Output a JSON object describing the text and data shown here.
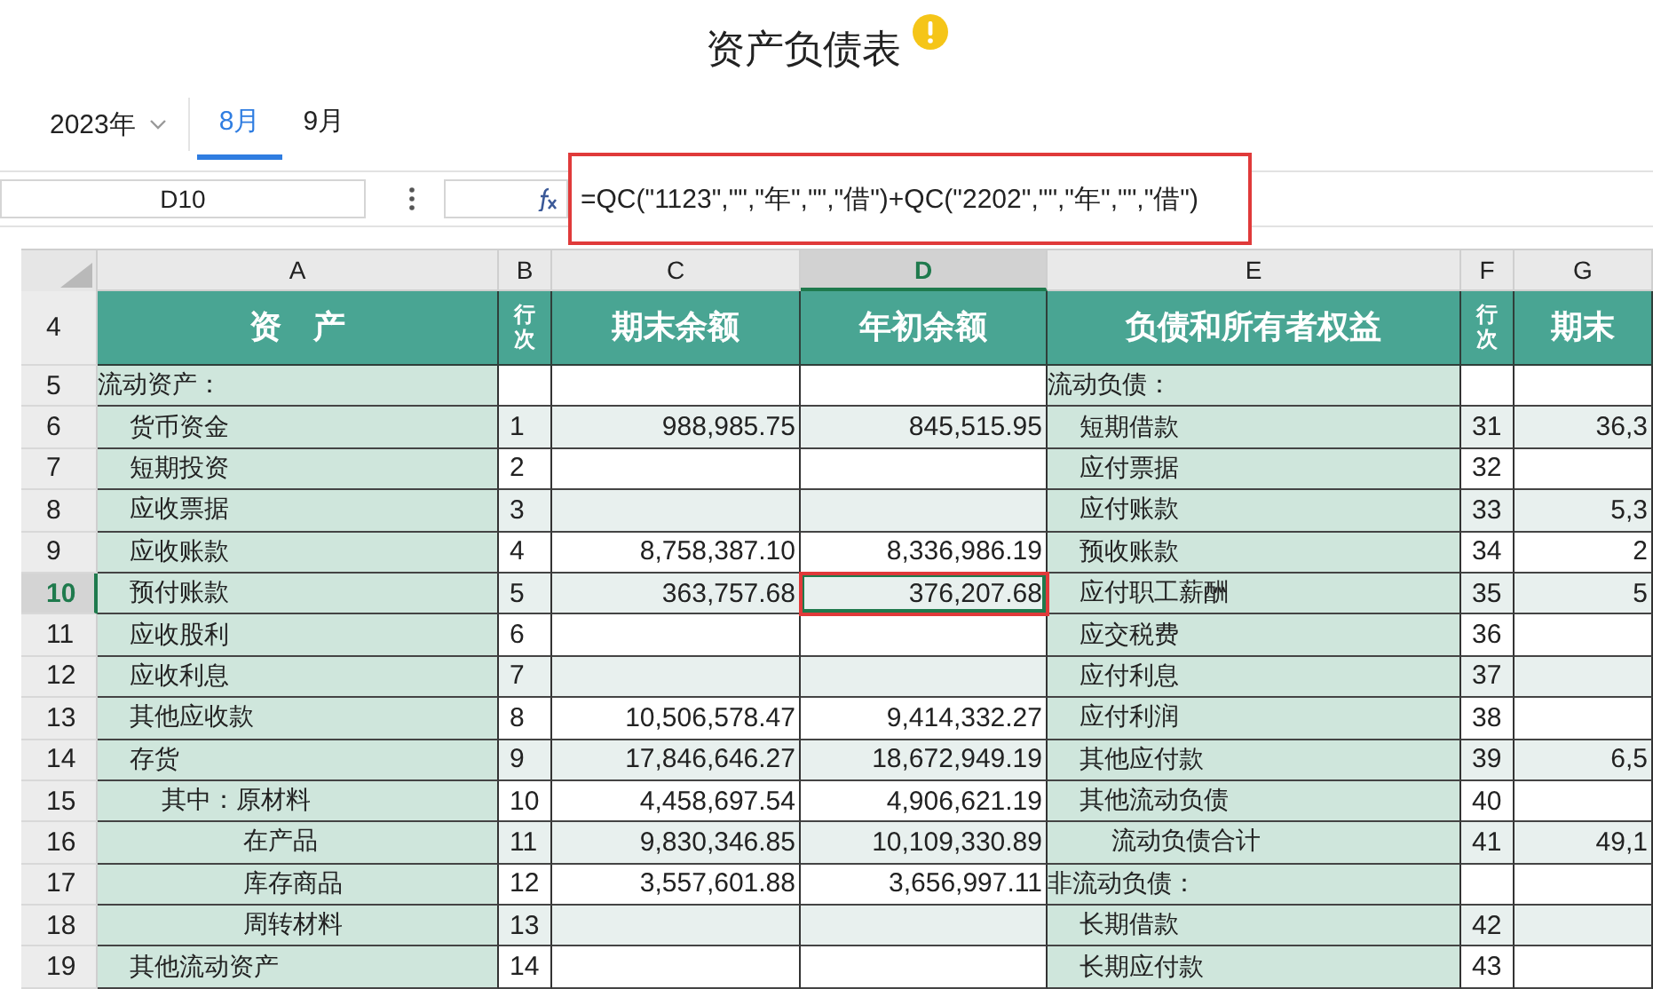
{
  "title": "资产负债表",
  "period": {
    "year": "2023年",
    "months": [
      {
        "label": "8月",
        "selected": true
      },
      {
        "label": "9月",
        "selected": false
      }
    ]
  },
  "formula_bar": {
    "cell_ref": "D10",
    "formula": "=QC(\"1123\",\"\",\"年\",\"\",\"借\")+QC(\"2202\",\"\",\"年\",\"\",\"借\")"
  },
  "sheet": {
    "columns": [
      {
        "label": "A",
        "selected": false
      },
      {
        "label": "B",
        "selected": false
      },
      {
        "label": "C",
        "selected": false
      },
      {
        "label": "D",
        "selected": true
      },
      {
        "label": "E",
        "selected": false
      },
      {
        "label": "F",
        "selected": false
      },
      {
        "label": "G",
        "selected": false
      }
    ],
    "header": {
      "number": "4",
      "selected": false,
      "cells": [
        "资　产",
        "行次",
        "期末余额",
        "年初余额",
        "负债和所有者权益",
        "行次",
        "期末"
      ]
    },
    "rows": [
      {
        "number": "5",
        "selected": false,
        "asset": {
          "text": "流动资产：",
          "kind": "section"
        },
        "line": "",
        "end": "",
        "start": "",
        "liability": {
          "text": "流动负债：",
          "kind": "section"
        },
        "line2": "",
        "end2": ""
      },
      {
        "number": "6",
        "selected": false,
        "asset": {
          "text": "货币资金",
          "kind": "item"
        },
        "line": "1",
        "end": "988,985.75",
        "start": "845,515.95",
        "liability": {
          "text": "短期借款",
          "kind": "item"
        },
        "line2": "31",
        "end2": "36,3"
      },
      {
        "number": "7",
        "selected": false,
        "asset": {
          "text": "短期投资",
          "kind": "item"
        },
        "line": "2",
        "end": "",
        "start": "",
        "liability": {
          "text": "应付票据",
          "kind": "item"
        },
        "line2": "32",
        "end2": ""
      },
      {
        "number": "8",
        "selected": false,
        "asset": {
          "text": "应收票据",
          "kind": "item"
        },
        "line": "3",
        "end": "",
        "start": "",
        "liability": {
          "text": "应付账款",
          "kind": "item"
        },
        "line2": "33",
        "end2": "5,3"
      },
      {
        "number": "9",
        "selected": false,
        "asset": {
          "text": "应收账款",
          "kind": "item"
        },
        "line": "4",
        "end": "8,758,387.10",
        "start": "8,336,986.19",
        "liability": {
          "text": "预收账款",
          "kind": "item"
        },
        "line2": "34",
        "end2": "2"
      },
      {
        "number": "10",
        "selected": true,
        "asset": {
          "text": "预付账款",
          "kind": "item"
        },
        "line": "5",
        "end": "363,757.68",
        "start": "376,207.68",
        "liability": {
          "text": "应付职工薪酬",
          "kind": "item"
        },
        "line2": "35",
        "end2": "5"
      },
      {
        "number": "11",
        "selected": false,
        "asset": {
          "text": "应收股利",
          "kind": "item"
        },
        "line": "6",
        "end": "",
        "start": "",
        "liability": {
          "text": "应交税费",
          "kind": "item"
        },
        "line2": "36",
        "end2": ""
      },
      {
        "number": "12",
        "selected": false,
        "asset": {
          "text": "应收利息",
          "kind": "item"
        },
        "line": "7",
        "end": "",
        "start": "",
        "liability": {
          "text": "应付利息",
          "kind": "item"
        },
        "line2": "37",
        "end2": ""
      },
      {
        "number": "13",
        "selected": false,
        "asset": {
          "text": "其他应收款",
          "kind": "item"
        },
        "line": "8",
        "end": "10,506,578.47",
        "start": "9,414,332.27",
        "liability": {
          "text": "应付利润",
          "kind": "item"
        },
        "line2": "38",
        "end2": ""
      },
      {
        "number": "14",
        "selected": false,
        "asset": {
          "text": "存货",
          "kind": "item"
        },
        "line": "9",
        "end": "17,846,646.27",
        "start": "18,672,949.19",
        "liability": {
          "text": "其他应付款",
          "kind": "item"
        },
        "line2": "39",
        "end2": "6,5"
      },
      {
        "number": "15",
        "selected": false,
        "asset": {
          "text": "其中：原材料",
          "kind": "sub"
        },
        "line": "10",
        "end": "4,458,697.54",
        "start": "4,906,621.19",
        "liability": {
          "text": "其他流动负债",
          "kind": "item"
        },
        "line2": "40",
        "end2": ""
      },
      {
        "number": "16",
        "selected": false,
        "asset": {
          "text": "在产品",
          "kind": "detail"
        },
        "line": "11",
        "end": "9,830,346.85",
        "start": "10,109,330.89",
        "liability": {
          "text": "流动负债合计",
          "kind": "total"
        },
        "line2": "41",
        "end2": "49,1"
      },
      {
        "number": "17",
        "selected": false,
        "asset": {
          "text": "库存商品",
          "kind": "detail"
        },
        "line": "12",
        "end": "3,557,601.88",
        "start": "3,656,997.11",
        "liability": {
          "text": "非流动负债：",
          "kind": "section"
        },
        "line2": "",
        "end2": ""
      },
      {
        "number": "18",
        "selected": false,
        "asset": {
          "text": "周转材料",
          "kind": "detail"
        },
        "line": "13",
        "end": "",
        "start": "",
        "liability": {
          "text": "长期借款",
          "kind": "item"
        },
        "line2": "42",
        "end2": ""
      },
      {
        "number": "19",
        "selected": false,
        "asset": {
          "text": "其他流动资产",
          "kind": "item"
        },
        "line": "14",
        "end": "",
        "start": "",
        "liability": {
          "text": "长期应付款",
          "kind": "item"
        },
        "line2": "43",
        "end2": ""
      }
    ]
  }
}
